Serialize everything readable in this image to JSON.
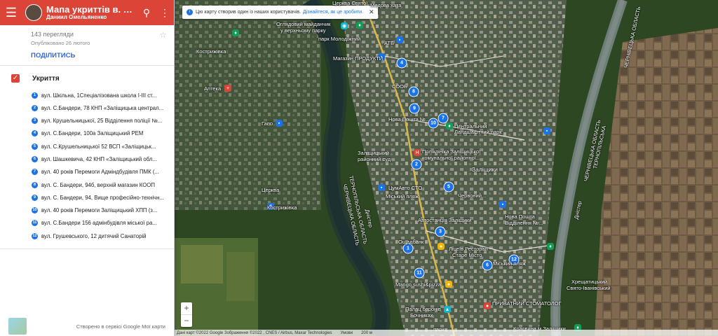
{
  "header": {
    "title": "Мапа укриттів в. Заліщики",
    "author": "Даниил Омельяненко",
    "menu_icon": "menu-icon",
    "search_icon": "search-icon",
    "more_icon": "more-vert-icon"
  },
  "meta": {
    "views": "143 перегляди",
    "published": "Опубліковано 26 лютого",
    "share": "ПОДІЛИТИСЬ"
  },
  "layer": {
    "title": "Укриття",
    "check": "✓",
    "items": [
      {
        "num": "1",
        "label": "вул. Шкільна, 1Спеціалізована школа І-ІІІ ст..."
      },
      {
        "num": "2",
        "label": "вул. С.Бандери, 78 КНП «Заліщицька централ..."
      },
      {
        "num": "3",
        "label": "вул. Крушельницької, 25 Відділення поліції №..."
      },
      {
        "num": "4",
        "label": "вул. С.Бандери, 100а Заліщицький РЕМ"
      },
      {
        "num": "5",
        "label": "вул. С.Крушельницької 52 ВСП «Заліщицьк..."
      },
      {
        "num": "6",
        "label": "вул. Шашкевича, 42 КНП «Заліщицький обл..."
      },
      {
        "num": "7",
        "label": "вул. 40 років Перемоги Адміндбудівля ПМК (..."
      },
      {
        "num": "8",
        "label": "вул. С. Бандери, 94б, верхній магазин КООП"
      },
      {
        "num": "9",
        "label": "вул. С. Бандери, 94, Вище професійно-технічн..."
      },
      {
        "num": "10",
        "label": "вул. 40 років Перемоги Заліщицький ХПП (з..."
      },
      {
        "num": "11",
        "label": "вул. С.Бандери 156 адмінбудівля міської ра..."
      },
      {
        "num": "12",
        "label": "вул. Грушевського, 12 дитячий Санаторій"
      }
    ]
  },
  "footer": {
    "text": "Створено в сервісі Google Мої карти"
  },
  "map": {
    "banner_text": "Цю карту створив один із наших користувачів.",
    "banner_link": "Дізнайтеся, як це зробити.",
    "banner_close": "✕",
    "zoom_in": "+",
    "zoom_out": "−",
    "attribution": "Дані карт ©2022 Google Зображення ©2022 , CNES / Airbus, Maxar Technologies",
    "terms": "Умови",
    "scale": "200 м",
    "labels": {
      "medova_khata": "Медова хата",
      "tserkva_top": "Церква Святої...",
      "ohliadovyi": "Оглядовий майданчик",
      "ohliadovyi2": "у верхньому парку",
      "park_molodizhnyi": "парк Молодіжний",
      "kostryzhivka": "Кострижівка",
      "atb": "АТБ",
      "mahazyn": "Магазин ПРОДУКТИ",
      "apteka": "Аптека",
      "soob": "СООБ",
      "nova_poshta": "Нова Пошта №...",
      "landshaftnyi": "Ландшафтний парк",
      "tsentralnyi": "Центральний",
      "hapo": "Гапо",
      "sud": "Заліщицький районний суд",
      "poliklinika": "Поліклініка Заліщицької комунальної районної...",
      "zalishchyky": "Заліщики",
      "tserkva": "Церква",
      "kostryzhivka2": "Кострижівка",
      "tsumavto": "ЦумАвто СТО",
      "plyazh": "Міський пляж",
      "chervonyi": "Червоний...",
      "avtostantsiia": "Автостанція Заліщики",
      "novaposhta2": "Нова Пошта Відділення №...",
      "oshchadbank": "Ощадбанк",
      "litseum": "Ліцеїв Ресторан",
      "stare_misto": "Старе Місто",
      "miskyi_plyazh2": "Міський пляж",
      "mango": "Mango sushi&pizza",
      "palats": "Палац баронів",
      "bochniak": "Бочниках",
      "park": "парк",
      "pryvatnyi": "ПРИВАТНИЙ СТОМАТОЛОГ",
      "khreshchatytskyi": "Хрещатицький",
      "sviato": "Свято-Іванівський",
      "krasvyna": "Красвина м.Заліщики",
      "ternopilska_v": "ТЕРНОПІЛЬСЬКА ОБЛАСТЬ",
      "chernivetska_v": "ЧЕРНІВЕЦЬКА ОБЛАСТЬ",
      "chernivetska_right": "ЧЕРНІВЕЦЬКА ОБЛАСТЬ",
      "ternopilska_right": "ТЕРНОПІЛЬСЬКА",
      "chernivetska_far": "ЧЕРНІВЕЦЬКА ОБЛАСТЬ",
      "dnister1": "Дністер",
      "dnister2": "Дністер"
    }
  }
}
